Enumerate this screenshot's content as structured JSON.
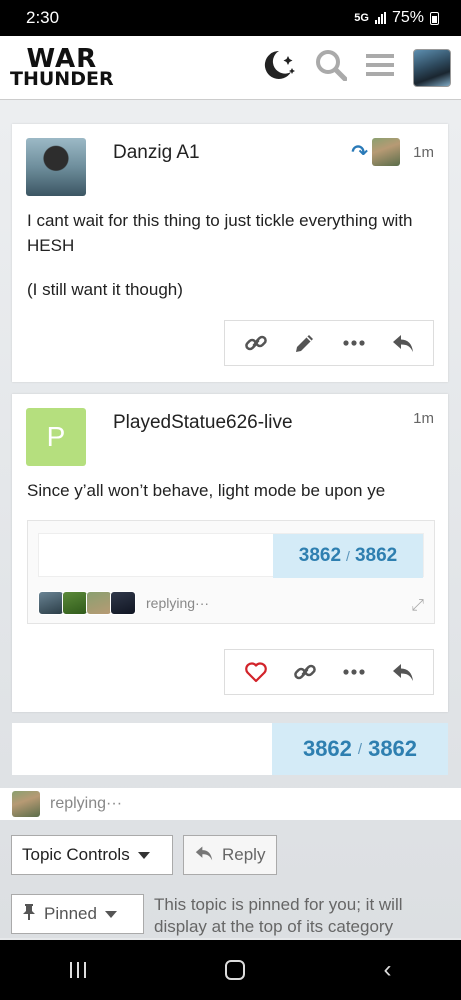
{
  "status_bar": {
    "time": "2:30",
    "network": "5G",
    "battery": "75%"
  },
  "header": {
    "logo_line1": "WAR",
    "logo_line2": "THUNDER",
    "icons": [
      "theme-toggle-icon",
      "search-icon",
      "hamburger-menu-icon",
      "user-avatar"
    ]
  },
  "posts": [
    {
      "username": "Danzig A1",
      "time": "1m",
      "reply_to_indicator": true,
      "paragraphs": [
        "I cant wait for this thing to just tickle everything with HESH",
        "(I still want it though)"
      ],
      "actions": [
        "link-icon",
        "edit-icon",
        "more-icon",
        "reply-icon"
      ]
    },
    {
      "username": "PlayedStatue626-live",
      "avatar_letter": "P",
      "time": "1m",
      "paragraphs": [
        "Since y’all won’t behave, light mode be upon ye"
      ],
      "embed": {
        "progress_current": "3862",
        "progress_sep": "/",
        "progress_total": "3862",
        "replying_text": "replying···"
      },
      "actions": [
        "heart-icon",
        "link-icon",
        "more-icon",
        "reply-icon"
      ]
    }
  ],
  "timeline": {
    "current": "3862",
    "sep": "/",
    "total": "3862"
  },
  "replying_bar": {
    "text": "replying···"
  },
  "footer": {
    "topic_controls_label": "Topic Controls",
    "reply_label": "Reply",
    "pinned_label": "Pinned",
    "pinned_note": "This topic is pinned for you; it will display at the top of its category"
  },
  "colors": {
    "accent": "#2e7fb0",
    "progress_bg": "#d4ebf7",
    "letter_avatar": "#b5df7e",
    "heart": "#d2232a"
  }
}
